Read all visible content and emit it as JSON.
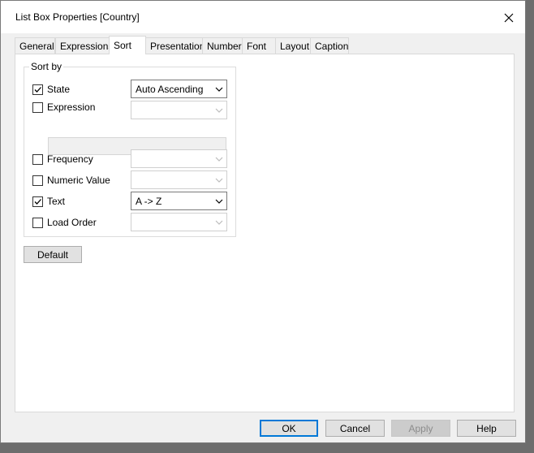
{
  "window": {
    "title": "List Box Properties [Country]"
  },
  "tabs": [
    {
      "label": "General"
    },
    {
      "label": "Expressions"
    },
    {
      "label": "Sort"
    },
    {
      "label": "Presentation"
    },
    {
      "label": "Number"
    },
    {
      "label": "Font"
    },
    {
      "label": "Layout"
    },
    {
      "label": "Caption"
    }
  ],
  "active_tab": "Sort",
  "sort_by": {
    "title": "Sort by",
    "rows": [
      {
        "label": "State",
        "checked": true,
        "combo_value": "Auto Ascending",
        "enabled": true
      },
      {
        "label": "Expression",
        "checked": false,
        "combo_value": "",
        "enabled": false
      },
      {
        "label": "Frequency",
        "checked": false,
        "combo_value": "",
        "enabled": false
      },
      {
        "label": "Numeric Value",
        "checked": false,
        "combo_value": "",
        "enabled": false
      },
      {
        "label": "Text",
        "checked": true,
        "combo_value": "A -> Z",
        "enabled": true
      },
      {
        "label": "Load Order",
        "checked": false,
        "combo_value": "",
        "enabled": false
      }
    ]
  },
  "buttons": {
    "default": "Default",
    "ok": "OK",
    "cancel": "Cancel",
    "apply": "Apply",
    "help": "Help"
  }
}
